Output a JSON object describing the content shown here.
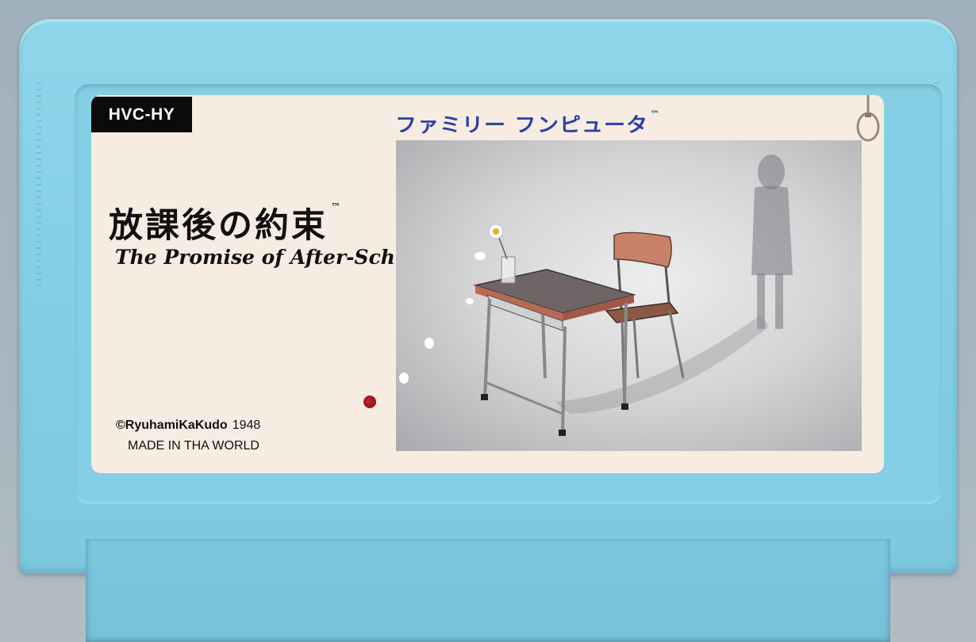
{
  "label": {
    "code": "HVC-HY",
    "brand": "ファミリー フンピュータ",
    "brand_tm": "™",
    "title_jp": "放課後の約束",
    "title_jp_tm": "™",
    "title_en": "The Promise of After-School",
    "title_en_tm": "™",
    "copyright": "©RyuhamiKaKudo",
    "copyright_year": "1948",
    "made_in": "MADE IN THA WORLD"
  },
  "colors": {
    "cartridge": "#86d0e6",
    "label_bg": "#f7ece1",
    "brand": "#2a3fa6",
    "blood": "#9c1620"
  },
  "icons": [
    "noose-icon",
    "blood-drop-icon"
  ]
}
